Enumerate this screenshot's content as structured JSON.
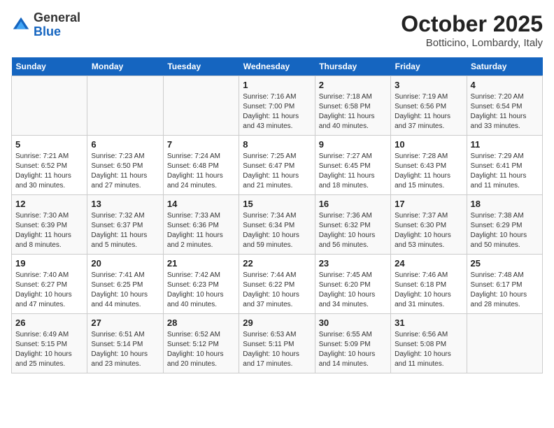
{
  "header": {
    "logo_general": "General",
    "logo_blue": "Blue",
    "month_title": "October 2025",
    "location": "Botticino, Lombardy, Italy"
  },
  "weekdays": [
    "Sunday",
    "Monday",
    "Tuesday",
    "Wednesday",
    "Thursday",
    "Friday",
    "Saturday"
  ],
  "weeks": [
    [
      {
        "day": "",
        "sunrise": "",
        "sunset": "",
        "daylight": ""
      },
      {
        "day": "",
        "sunrise": "",
        "sunset": "",
        "daylight": ""
      },
      {
        "day": "",
        "sunrise": "",
        "sunset": "",
        "daylight": ""
      },
      {
        "day": "1",
        "sunrise": "Sunrise: 7:16 AM",
        "sunset": "Sunset: 7:00 PM",
        "daylight": "Daylight: 11 hours and 43 minutes."
      },
      {
        "day": "2",
        "sunrise": "Sunrise: 7:18 AM",
        "sunset": "Sunset: 6:58 PM",
        "daylight": "Daylight: 11 hours and 40 minutes."
      },
      {
        "day": "3",
        "sunrise": "Sunrise: 7:19 AM",
        "sunset": "Sunset: 6:56 PM",
        "daylight": "Daylight: 11 hours and 37 minutes."
      },
      {
        "day": "4",
        "sunrise": "Sunrise: 7:20 AM",
        "sunset": "Sunset: 6:54 PM",
        "daylight": "Daylight: 11 hours and 33 minutes."
      }
    ],
    [
      {
        "day": "5",
        "sunrise": "Sunrise: 7:21 AM",
        "sunset": "Sunset: 6:52 PM",
        "daylight": "Daylight: 11 hours and 30 minutes."
      },
      {
        "day": "6",
        "sunrise": "Sunrise: 7:23 AM",
        "sunset": "Sunset: 6:50 PM",
        "daylight": "Daylight: 11 hours and 27 minutes."
      },
      {
        "day": "7",
        "sunrise": "Sunrise: 7:24 AM",
        "sunset": "Sunset: 6:48 PM",
        "daylight": "Daylight: 11 hours and 24 minutes."
      },
      {
        "day": "8",
        "sunrise": "Sunrise: 7:25 AM",
        "sunset": "Sunset: 6:47 PM",
        "daylight": "Daylight: 11 hours and 21 minutes."
      },
      {
        "day": "9",
        "sunrise": "Sunrise: 7:27 AM",
        "sunset": "Sunset: 6:45 PM",
        "daylight": "Daylight: 11 hours and 18 minutes."
      },
      {
        "day": "10",
        "sunrise": "Sunrise: 7:28 AM",
        "sunset": "Sunset: 6:43 PM",
        "daylight": "Daylight: 11 hours and 15 minutes."
      },
      {
        "day": "11",
        "sunrise": "Sunrise: 7:29 AM",
        "sunset": "Sunset: 6:41 PM",
        "daylight": "Daylight: 11 hours and 11 minutes."
      }
    ],
    [
      {
        "day": "12",
        "sunrise": "Sunrise: 7:30 AM",
        "sunset": "Sunset: 6:39 PM",
        "daylight": "Daylight: 11 hours and 8 minutes."
      },
      {
        "day": "13",
        "sunrise": "Sunrise: 7:32 AM",
        "sunset": "Sunset: 6:37 PM",
        "daylight": "Daylight: 11 hours and 5 minutes."
      },
      {
        "day": "14",
        "sunrise": "Sunrise: 7:33 AM",
        "sunset": "Sunset: 6:36 PM",
        "daylight": "Daylight: 11 hours and 2 minutes."
      },
      {
        "day": "15",
        "sunrise": "Sunrise: 7:34 AM",
        "sunset": "Sunset: 6:34 PM",
        "daylight": "Daylight: 10 hours and 59 minutes."
      },
      {
        "day": "16",
        "sunrise": "Sunrise: 7:36 AM",
        "sunset": "Sunset: 6:32 PM",
        "daylight": "Daylight: 10 hours and 56 minutes."
      },
      {
        "day": "17",
        "sunrise": "Sunrise: 7:37 AM",
        "sunset": "Sunset: 6:30 PM",
        "daylight": "Daylight: 10 hours and 53 minutes."
      },
      {
        "day": "18",
        "sunrise": "Sunrise: 7:38 AM",
        "sunset": "Sunset: 6:29 PM",
        "daylight": "Daylight: 10 hours and 50 minutes."
      }
    ],
    [
      {
        "day": "19",
        "sunrise": "Sunrise: 7:40 AM",
        "sunset": "Sunset: 6:27 PM",
        "daylight": "Daylight: 10 hours and 47 minutes."
      },
      {
        "day": "20",
        "sunrise": "Sunrise: 7:41 AM",
        "sunset": "Sunset: 6:25 PM",
        "daylight": "Daylight: 10 hours and 44 minutes."
      },
      {
        "day": "21",
        "sunrise": "Sunrise: 7:42 AM",
        "sunset": "Sunset: 6:23 PM",
        "daylight": "Daylight: 10 hours and 40 minutes."
      },
      {
        "day": "22",
        "sunrise": "Sunrise: 7:44 AM",
        "sunset": "Sunset: 6:22 PM",
        "daylight": "Daylight: 10 hours and 37 minutes."
      },
      {
        "day": "23",
        "sunrise": "Sunrise: 7:45 AM",
        "sunset": "Sunset: 6:20 PM",
        "daylight": "Daylight: 10 hours and 34 minutes."
      },
      {
        "day": "24",
        "sunrise": "Sunrise: 7:46 AM",
        "sunset": "Sunset: 6:18 PM",
        "daylight": "Daylight: 10 hours and 31 minutes."
      },
      {
        "day": "25",
        "sunrise": "Sunrise: 7:48 AM",
        "sunset": "Sunset: 6:17 PM",
        "daylight": "Daylight: 10 hours and 28 minutes."
      }
    ],
    [
      {
        "day": "26",
        "sunrise": "Sunrise: 6:49 AM",
        "sunset": "Sunset: 5:15 PM",
        "daylight": "Daylight: 10 hours and 25 minutes."
      },
      {
        "day": "27",
        "sunrise": "Sunrise: 6:51 AM",
        "sunset": "Sunset: 5:14 PM",
        "daylight": "Daylight: 10 hours and 23 minutes."
      },
      {
        "day": "28",
        "sunrise": "Sunrise: 6:52 AM",
        "sunset": "Sunset: 5:12 PM",
        "daylight": "Daylight: 10 hours and 20 minutes."
      },
      {
        "day": "29",
        "sunrise": "Sunrise: 6:53 AM",
        "sunset": "Sunset: 5:11 PM",
        "daylight": "Daylight: 10 hours and 17 minutes."
      },
      {
        "day": "30",
        "sunrise": "Sunrise: 6:55 AM",
        "sunset": "Sunset: 5:09 PM",
        "daylight": "Daylight: 10 hours and 14 minutes."
      },
      {
        "day": "31",
        "sunrise": "Sunrise: 6:56 AM",
        "sunset": "Sunset: 5:08 PM",
        "daylight": "Daylight: 10 hours and 11 minutes."
      },
      {
        "day": "",
        "sunrise": "",
        "sunset": "",
        "daylight": ""
      }
    ]
  ]
}
